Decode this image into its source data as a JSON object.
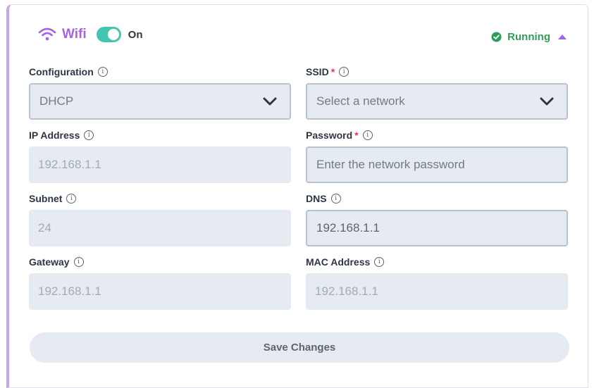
{
  "header": {
    "wifi_label": "Wifi",
    "toggle_label": "On",
    "toggle_on": true,
    "status_text": "Running"
  },
  "fields": {
    "configuration": {
      "label": "Configuration",
      "value": "DHCP"
    },
    "ssid": {
      "label": "SSID",
      "required_mark": "*",
      "placeholder": "Select a network"
    },
    "ip_address": {
      "label": "IP Address",
      "value": "192.168.1.1"
    },
    "password": {
      "label": "Password",
      "required_mark": "*",
      "placeholder": "Enter the network password"
    },
    "subnet": {
      "label": "Subnet",
      "value": "24"
    },
    "dns": {
      "label": "DNS",
      "value": "192.168.1.1"
    },
    "gateway": {
      "label": "Gateway",
      "value": "192.168.1.1"
    },
    "mac_address": {
      "label": "MAC Address",
      "value": "192.168.1.1"
    }
  },
  "info_glyph": "i",
  "save_label": "Save Changes",
  "colors": {
    "accent": "#a661e6",
    "toggle": "#45c4b0",
    "running": "#2f9e5a",
    "required": "#e0394d",
    "field_bg": "#e6eaf1"
  }
}
